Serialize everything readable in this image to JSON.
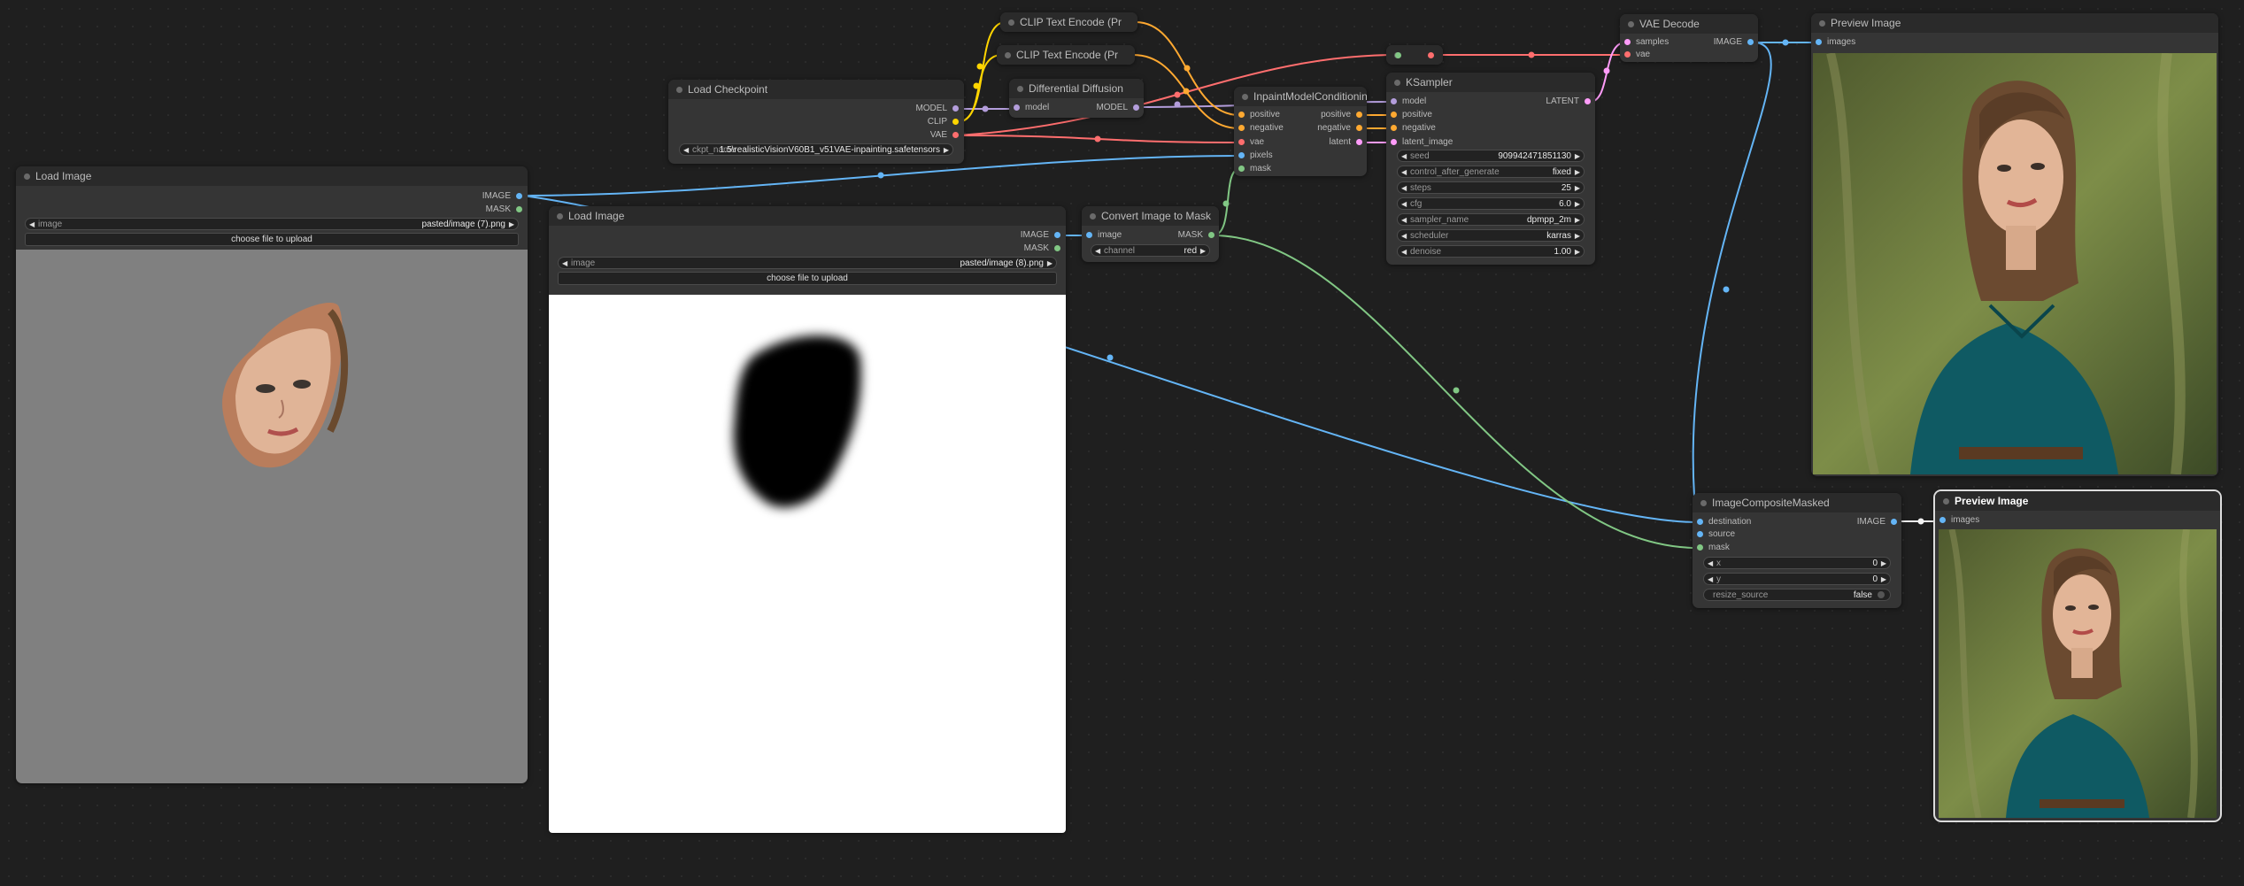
{
  "nodes": {
    "load_image_1": {
      "title": "Load Image",
      "out_image": "IMAGE",
      "out_mask": "MASK",
      "image_label": "image",
      "image_value": "pasted/image (7).png",
      "upload": "choose file to upload"
    },
    "load_image_2": {
      "title": "Load Image",
      "out_image": "IMAGE",
      "out_mask": "MASK",
      "image_label": "image",
      "image_value": "pasted/image (8).png",
      "upload": "choose file to upload"
    },
    "load_checkpoint": {
      "title": "Load Checkpoint",
      "out_model": "MODEL",
      "out_clip": "CLIP",
      "out_vae": "VAE",
      "ckpt_label": "ckpt_name",
      "ckpt_value": "1.5\\realisticVisionV60B1_v51VAE-inpainting.safetensors"
    },
    "clip_text_1": {
      "title": "CLIP Text Encode (Pr"
    },
    "clip_text_2": {
      "title": "CLIP Text Encode (Pr"
    },
    "differential_diffusion": {
      "title": "Differential Diffusion",
      "in_model": "model",
      "out_model": "MODEL"
    },
    "inpaint_conditioning": {
      "title": "InpaintModelConditioning",
      "inputs": [
        "positive",
        "negative",
        "vae",
        "pixels",
        "mask"
      ],
      "outputs": [
        "positive",
        "negative",
        "latent"
      ]
    },
    "ksampler": {
      "title": "KSampler",
      "inputs": [
        "model",
        "positive",
        "negative",
        "latent_image"
      ],
      "out_latent": "LATENT",
      "widgets": [
        {
          "label": "seed",
          "value": "909942471851130"
        },
        {
          "label": "control_after_generate",
          "value": "fixed"
        },
        {
          "label": "steps",
          "value": "25"
        },
        {
          "label": "cfg",
          "value": "6.0"
        },
        {
          "label": "sampler_name",
          "value": "dpmpp_2m"
        },
        {
          "label": "scheduler",
          "value": "karras"
        },
        {
          "label": "denoise",
          "value": "1.00"
        }
      ]
    },
    "convert_mask": {
      "title": "Convert Image to Mask",
      "in_image": "image",
      "out_mask": "MASK",
      "channel_label": "channel",
      "channel_value": "red"
    },
    "vae_decode": {
      "title": "VAE Decode",
      "in_samples": "samples",
      "in_vae": "vae",
      "out_image": "IMAGE"
    },
    "preview_1": {
      "title": "Preview Image",
      "in_images": "images"
    },
    "composite": {
      "title": "ImageCompositeMasked",
      "inputs": [
        "destination",
        "source",
        "mask"
      ],
      "out_image": "IMAGE",
      "widgets": [
        {
          "label": "x",
          "value": "0"
        },
        {
          "label": "y",
          "value": "0"
        }
      ],
      "resize_label": "resize_source",
      "resize_value": "false"
    },
    "preview_2": {
      "title": "Preview Image",
      "in_images": "images"
    }
  },
  "colors": {
    "image": "#64b5f6",
    "mask": "#81c784",
    "model": "#b39ddb",
    "clip": "#ffd500",
    "vae": "#ff6e6e",
    "conditioning": "#ffa931",
    "latent": "#ff9cf9"
  }
}
